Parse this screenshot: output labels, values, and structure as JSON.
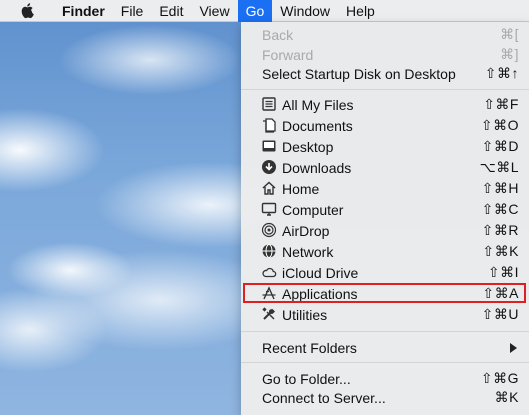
{
  "menubar": {
    "app_name": "Finder",
    "items": [
      "File",
      "Edit",
      "View",
      "Go",
      "Window",
      "Help"
    ]
  },
  "go_menu": {
    "back": {
      "label": "Back",
      "shortcut": "⌘["
    },
    "forward": {
      "label": "Forward",
      "shortcut": "⌘]"
    },
    "startup": {
      "label": "Select Startup Disk on Desktop",
      "shortcut": "⇧⌘↑"
    },
    "places": [
      {
        "label": "All My Files",
        "shortcut": "⇧⌘F",
        "icon": "all-files-icon"
      },
      {
        "label": "Documents",
        "shortcut": "⇧⌘O",
        "icon": "documents-icon"
      },
      {
        "label": "Desktop",
        "shortcut": "⇧⌘D",
        "icon": "desktop-icon"
      },
      {
        "label": "Downloads",
        "shortcut": "⌥⌘L",
        "icon": "downloads-icon"
      },
      {
        "label": "Home",
        "shortcut": "⇧⌘H",
        "icon": "home-icon"
      },
      {
        "label": "Computer",
        "shortcut": "⇧⌘C",
        "icon": "computer-icon"
      },
      {
        "label": "AirDrop",
        "shortcut": "⇧⌘R",
        "icon": "airdrop-icon"
      },
      {
        "label": "Network",
        "shortcut": "⇧⌘K",
        "icon": "network-icon"
      },
      {
        "label": "iCloud Drive",
        "shortcut": "⇧⌘I",
        "icon": "icloud-icon"
      },
      {
        "label": "Applications",
        "shortcut": "⇧⌘A",
        "icon": "applications-icon"
      },
      {
        "label": "Utilities",
        "shortcut": "⇧⌘U",
        "icon": "utilities-icon"
      }
    ],
    "recent_folders": {
      "label": "Recent Folders"
    },
    "go_to_folder": {
      "label": "Go to Folder...",
      "shortcut": "⇧⌘G"
    },
    "connect_server": {
      "label": "Connect to Server...",
      "shortcut": "⌘K"
    }
  },
  "colors": {
    "menu_highlight": "#1b6ff3",
    "annotation_box": "#e02020"
  }
}
